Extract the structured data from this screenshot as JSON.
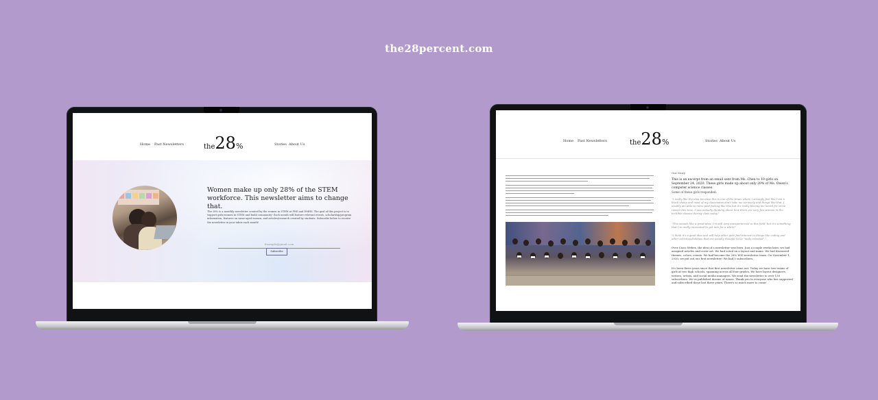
{
  "site_url": "the28percent.com",
  "colors": {
    "background": "#b29acc",
    "text_on_background": "#ffffff"
  },
  "nav": {
    "left_items": [
      "Home",
      "Past Newsletters"
    ],
    "right_items": [
      "Stories",
      "About Us"
    ]
  },
  "logo": {
    "prefix": "the",
    "number": "28",
    "suffix": "%"
  },
  "homepage": {
    "headline": "Women make up only 28% of the STEM workforce. This newsletter aims to change that.",
    "body": "The 28% is a monthly newsletter created by the women in STEM at PHS and DMHS. The goal of this project is to support girls/women in STEM and build community! Each month will feature relevant events, scholarship/program information, features on same-aged women, and articles/research created by students. Subscribe below to receive the newsletter in your inbox each month!",
    "email_placeholder": "Example@gmail.com",
    "subscribe_label": "Subscribe",
    "image_icon": "students-photo"
  },
  "story_page": {
    "sidebar_title": "Our Story",
    "lead": "This is an excerpt from an email sent from Ms. Chen to 10 girls on September 24, 2020. These girls made up about only 20% of Ms. Owen's computer science classes.",
    "subheading": "Some of these girls responded:",
    "quotes": [
      "\"I really like the idea because this is one of the times where I strongly feel like I am a black sheep and most of my classmates don't take me seriously and things like that. I usually am able to move past feeling like this but it's really blaring me heard for some reason this time. I was actually thinking about how there are very few women in the tech/bio classes during class today.\"",
      "\"This sounds like a great idea! I'm still very unexperienced in this field, but it's something that I'm really interested to get into for a while!\"",
      "\"I think it's a good idea and will help other girls find interest in things like coding and other activities/hobbies that are usually thought to be \"male-oriented\".\""
    ],
    "paragraphs": [
      "Over Cisco Webex, the idea of a newsletter was born. Just a couple weeks later, we had assigned articles and cover art. We had voted on a layout and name. We had discussed themes, colors, events. We had become the 28% WIS newsletter team. On November 1, 2020, we put out our first newsletter! We had 5 subscribers.",
      "It's been three years since that first newsletter came out. Today we have two teams of girls at two high schools, spanning across all four grades. We have layout designers, writers, artists, and social media managers. We send the newsletter to over 150 subscribers. We've published dozens of issues. Thank you to everyone who has supported and subscribed these last three years. There's so much more to come!"
    ],
    "image_icon": "group-photo"
  }
}
